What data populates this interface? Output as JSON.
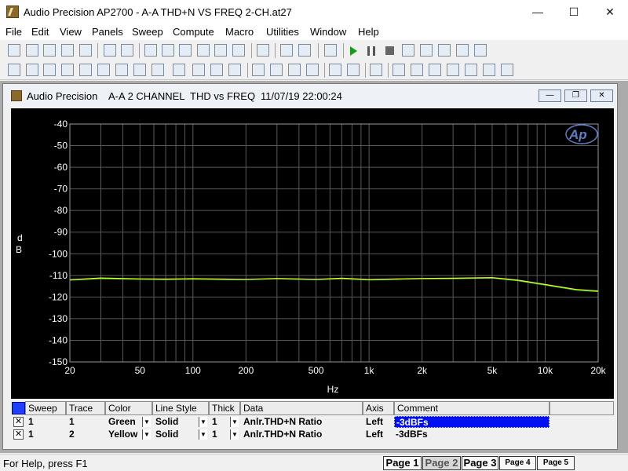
{
  "window": {
    "title": "Audio Precision AP2700 - A-A THD+N VS FREQ 2-CH.at27"
  },
  "menu": [
    "File",
    "Edit",
    "View",
    "Panels",
    "Sweep",
    "Compute",
    "Macro",
    "Utilities",
    "Window",
    "Help"
  ],
  "child": {
    "app": "Audio Precision",
    "title": "A-A 2 CHANNEL  THD vs FREQ",
    "timestamp": "11/07/19 22:00:24"
  },
  "chart_data": {
    "type": "line",
    "xlabel": "Hz",
    "ylabel": "d\nB",
    "x_scale": "log",
    "xlim": [
      20,
      20000
    ],
    "ylim": [
      -150,
      -40
    ],
    "y_ticks": [
      "-40",
      "-50",
      "-60",
      "-70",
      "-80",
      "-90",
      "-100",
      "-110",
      "-120",
      "-130",
      "-140",
      "-150"
    ],
    "x_ticks": [
      "20",
      "50",
      "100",
      "200",
      "500",
      "1k",
      "2k",
      "5k",
      "10k",
      "20k"
    ],
    "grid": true,
    "logo": "Ap",
    "series": [
      {
        "name": "",
        "color": "#1fd21f",
        "x": [
          20,
          30,
          50,
          70,
          100,
          150,
          200,
          300,
          500,
          700,
          1000,
          1500,
          2000,
          3000,
          5000,
          7000,
          10000,
          15000,
          20000
        ],
        "y": [
          -112.2,
          -111.5,
          -111.8,
          -111.9,
          -111.7,
          -111.9,
          -112.0,
          -111.6,
          -112.0,
          -111.5,
          -112.1,
          -111.8,
          -111.6,
          -111.5,
          -111.2,
          -112.5,
          -114.5,
          -116.8,
          -117.5
        ]
      },
      {
        "name": "",
        "color": "#f2f22a",
        "x": [
          20,
          30,
          50,
          70,
          100,
          150,
          200,
          300,
          500,
          700,
          1000,
          1500,
          2000,
          3000,
          5000,
          7000,
          10000,
          15000,
          20000
        ],
        "y": [
          -112.0,
          -111.2,
          -111.6,
          -111.7,
          -111.5,
          -111.7,
          -111.8,
          -111.4,
          -111.8,
          -111.3,
          -111.9,
          -111.6,
          -111.4,
          -111.3,
          -111.0,
          -112.2,
          -114.2,
          -116.5,
          -117.2
        ]
      }
    ]
  },
  "trace_table": {
    "headers": [
      "Sweep",
      "Trace",
      "Color",
      "Line Style",
      "Thick",
      "Data",
      "Axis",
      "Comment"
    ],
    "rows": [
      {
        "checked": "✕",
        "sweep": "1",
        "trace": "1",
        "color": "Green",
        "line_style": "Solid",
        "thick": "1",
        "data": "Anlr.THD+N Ratio",
        "axis": "Left",
        "comment": "-3dBFs"
      },
      {
        "checked": "✕",
        "sweep": "1",
        "trace": "2",
        "color": "Yellow",
        "line_style": "Solid",
        "thick": "1",
        "data": "Anlr.THD+N Ratio",
        "axis": "Left",
        "comment": "-3dBFs"
      }
    ]
  },
  "status": {
    "help": "For Help, press F1"
  },
  "pages": [
    "Page 1",
    "Page 2",
    "Page 3",
    "Page 4",
    "Page 5"
  ]
}
